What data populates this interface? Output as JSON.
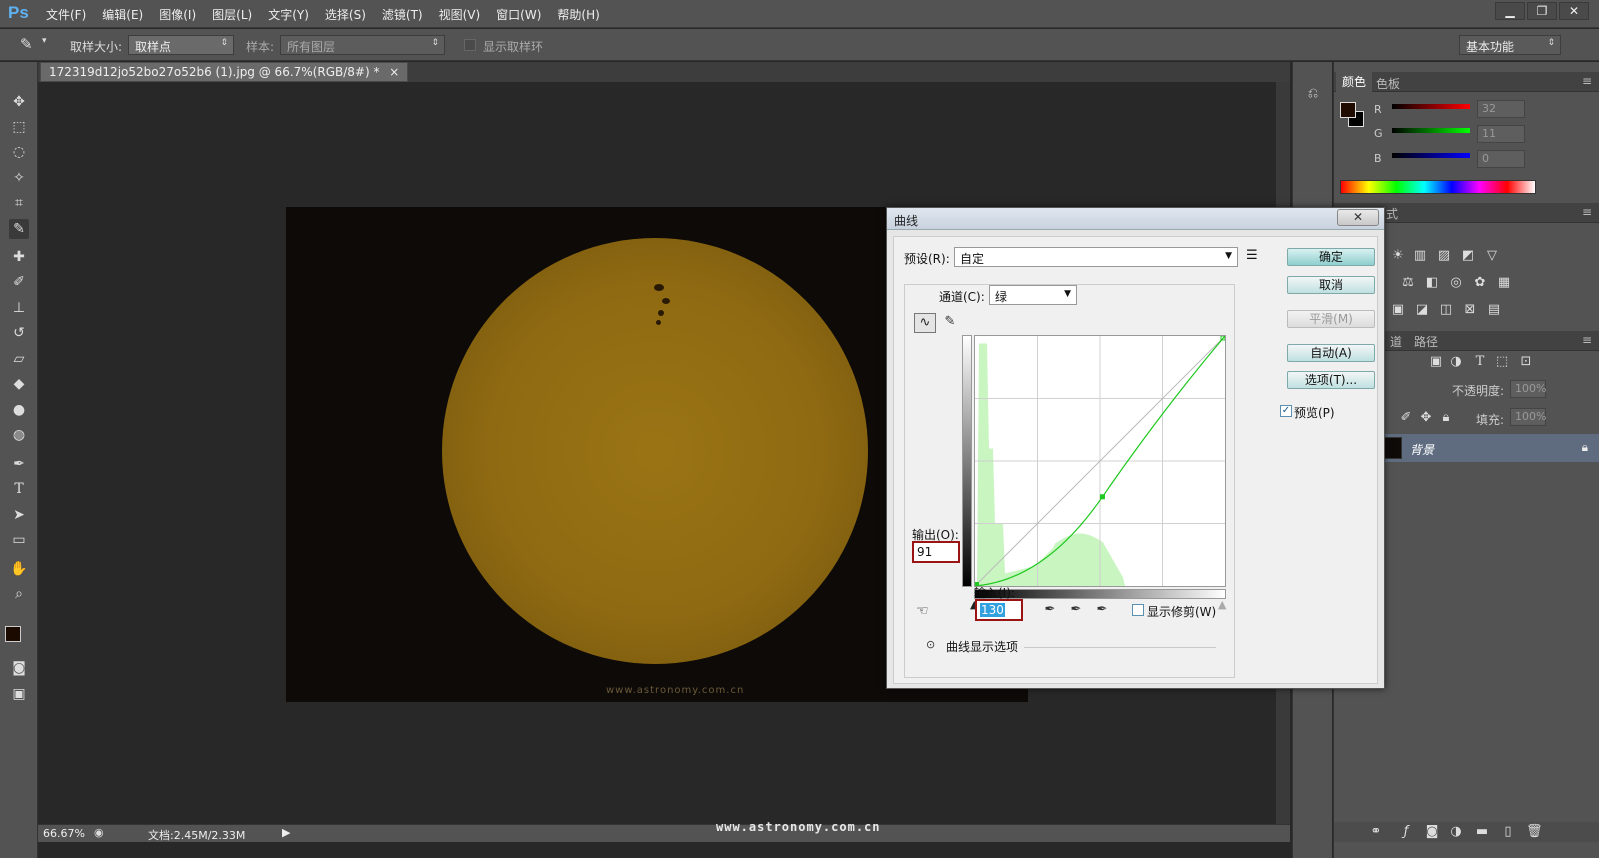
{
  "app": {
    "logo": "Ps",
    "menu": [
      "文件(F)",
      "编辑(E)",
      "图像(I)",
      "图层(L)",
      "文字(Y)",
      "选择(S)",
      "滤镜(T)",
      "视图(V)",
      "窗口(W)",
      "帮助(H)"
    ],
    "window_controls": [
      "▁",
      "❐",
      "✕"
    ]
  },
  "options_bar": {
    "sample_size_label": "取样大小:",
    "sample_size_value": "取样点",
    "sample_label": "样本:",
    "sample_value": "所有图层",
    "show_ring_label": "显示取样环",
    "workspace": "基本功能"
  },
  "document": {
    "tab_title": "172319d12jo52bo27o52b6 (1).jpg @ 66.7%(RGB/8#) *",
    "close": "×",
    "photo_watermark": "www.astronomy.com.cn"
  },
  "status": {
    "zoom": "66.67%",
    "doc_info": "文档:2.45M/2.33M",
    "arrow": "▶"
  },
  "footer_watermark": "www.astronomy.com.cn",
  "color_panel": {
    "tabs": [
      "颜色",
      "色板"
    ],
    "channels": [
      {
        "label": "R",
        "value": "32",
        "color": "#ff2020"
      },
      {
        "label": "G",
        "value": "11",
        "color": "#20d020"
      },
      {
        "label": "B",
        "value": "0",
        "color": "#2040ff"
      }
    ]
  },
  "adjust_panel": {
    "tab_partial": "式"
  },
  "layers_panel": {
    "tabs": [
      "道",
      "路径"
    ],
    "opacity_label": "不透明度:",
    "opacity_value": "100%",
    "fill_label": "填充:",
    "fill_value": "100%",
    "layer_name": "背景"
  },
  "curves_dialog": {
    "title": "曲线",
    "close": "✕",
    "preset_label": "预设(R):",
    "preset_value": "自定",
    "channel_label": "通道(C):",
    "channel_value": "绿",
    "output_label": "输出(O):",
    "output_value": "91",
    "input_label": "输入(I):",
    "input_value": "130",
    "show_clipping_label": "显示修剪(W)",
    "display_options_label": "曲线显示选项",
    "buttons": {
      "ok": "确定",
      "cancel": "取消",
      "smooth": "平滑(M)",
      "auto": "自动(A)",
      "options": "选项(T)..."
    },
    "preview_label": "预览(P)",
    "preview_checked": "✓",
    "curve_color": "#1ec81e",
    "histogram_color": "#c8f5c0"
  }
}
